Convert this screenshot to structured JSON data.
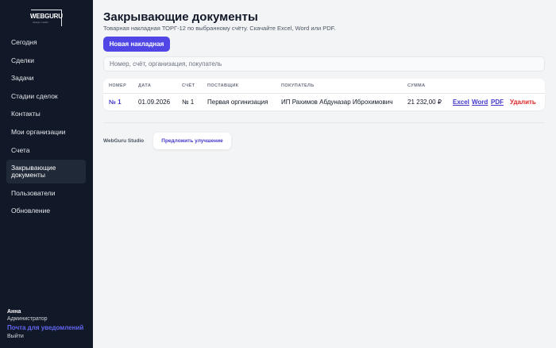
{
  "sidebar": {
    "logo": {
      "brand": "WEBGURU",
      "tagline": "design studio"
    },
    "items": [
      {
        "label": "Сегодня"
      },
      {
        "label": "Сделки"
      },
      {
        "label": "Задачи"
      },
      {
        "label": "Стадии сделок"
      },
      {
        "label": "Контакты"
      },
      {
        "label": "Мои организации"
      },
      {
        "label": "Счета"
      },
      {
        "label": "Закрывающие документы",
        "active": true
      },
      {
        "label": "Пользователи"
      },
      {
        "label": "Обновление"
      }
    ],
    "user": {
      "name": "Анна",
      "role": "Администратор",
      "notify_link": "Почта для уведомлений",
      "logout": "Выйти"
    }
  },
  "main": {
    "title": "Закрывающие документы",
    "subtitle": "Товарная накладная ТОРГ-12 по выбранному счёту. Скачайте Excel, Word или PDF.",
    "new_button": "Новая накладная",
    "search_placeholder": "Номер, счёт, организация, покупатель",
    "table": {
      "headers": {
        "number": "НОМЕР",
        "date": "ДАТА",
        "invoice": "СЧЁТ",
        "supplier": "ПОСТАВЩИК",
        "buyer": "ПОКУПАТЕЛЬ",
        "sum": "СУММА"
      },
      "rows": [
        {
          "number": "№ 1",
          "date": "01.09.2026",
          "invoice": "№ 1",
          "supplier": "Первая оргинизация",
          "buyer": "ИП Рахимов Абдуназар Иброхимович",
          "sum": "21 232,00 ₽",
          "actions": {
            "excel": "Excel",
            "word": "Word",
            "pdf": "PDF",
            "delete": "Удалить"
          }
        }
      ]
    },
    "footer": {
      "brand": "WebGuru Studio",
      "suggest_button": "Предложить улучшение"
    }
  },
  "colors": {
    "sidebar_bg": "#111827",
    "accent": "#4f46e5",
    "link": "#4338ca",
    "danger": "#dc2626",
    "page_bg": "#f3f4f6"
  }
}
